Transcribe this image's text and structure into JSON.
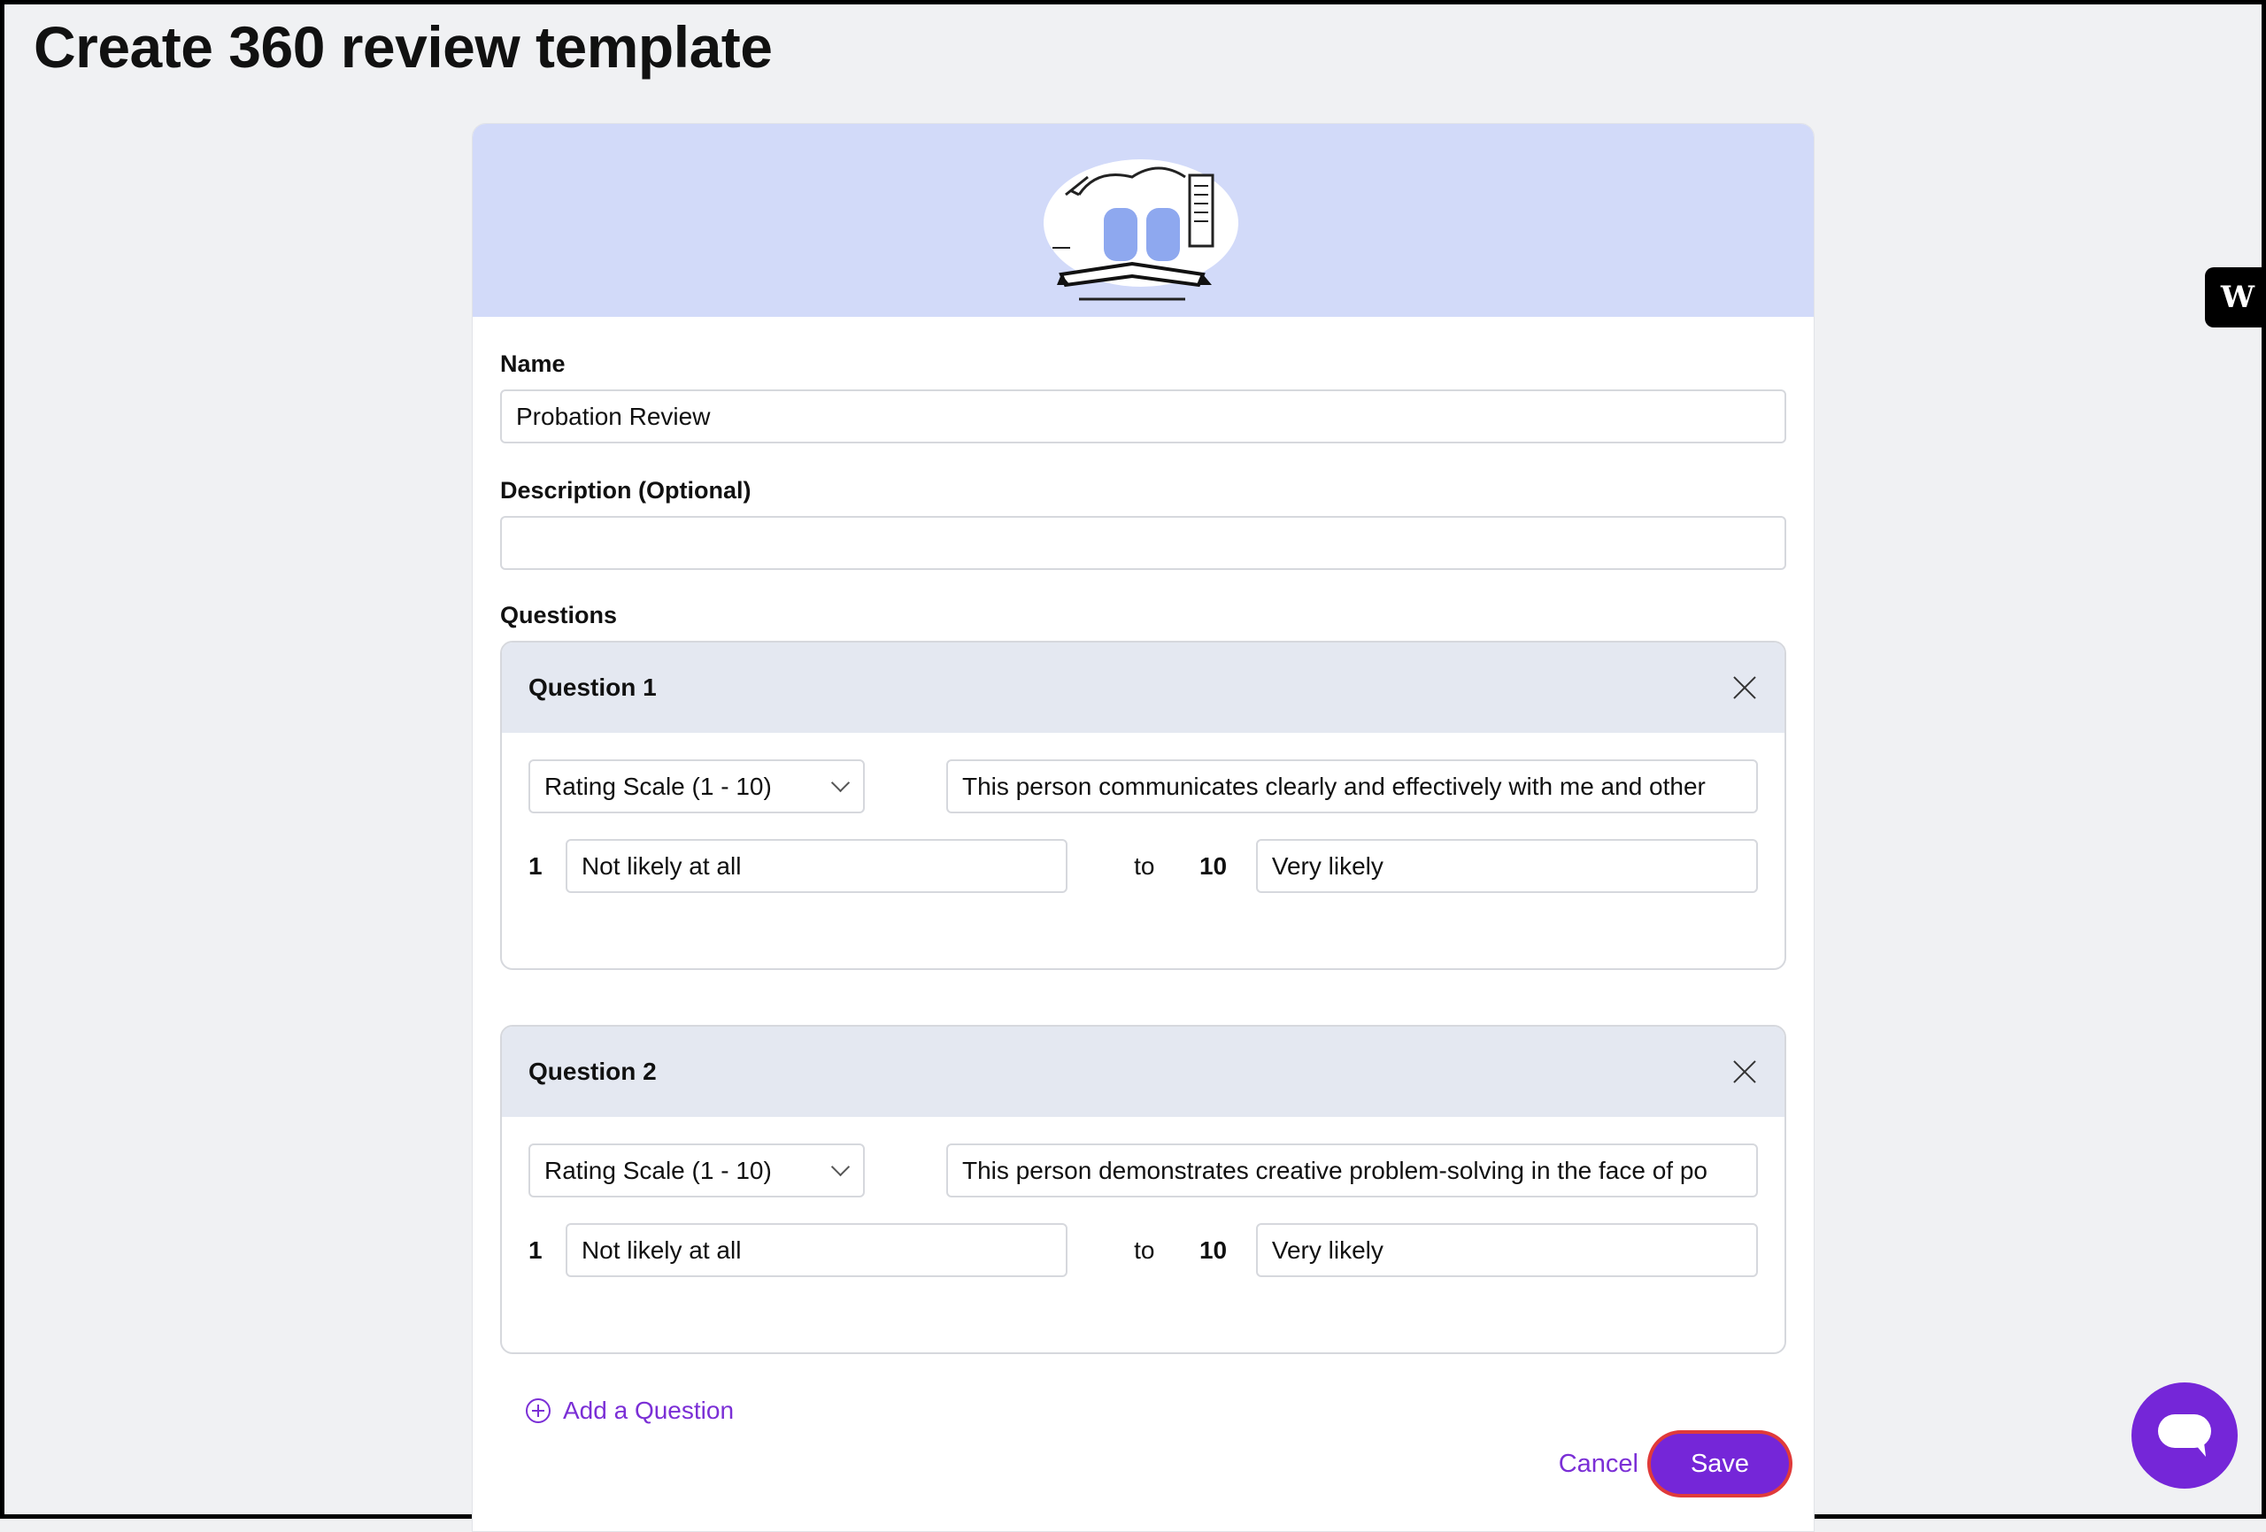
{
  "page": {
    "title": "Create 360 review template"
  },
  "form": {
    "name_label": "Name",
    "name_value": "Probation Review",
    "description_label": "Description (Optional)",
    "description_value": "",
    "questions_label": "Questions"
  },
  "questions": [
    {
      "title": "Question 1",
      "type": "Rating Scale (1 - 10)",
      "text": "This person communicates clearly and effectively with me and other",
      "low_num": "1",
      "low_label": "Not likely at all",
      "to": "to",
      "high_num": "10",
      "high_label": "Very likely"
    },
    {
      "title": "Question 2",
      "type": "Rating Scale (1 - 10)",
      "text": "This person demonstrates creative problem-solving in the face of po",
      "low_num": "1",
      "low_label": "Not likely at all",
      "to": "to",
      "high_num": "10",
      "high_label": "Very likely"
    }
  ],
  "actions": {
    "add_question": "Add a Question",
    "cancel": "Cancel",
    "save": "Save"
  },
  "badge": {
    "letter": "W"
  },
  "icons": {
    "close": "close-icon",
    "chevron": "chevron-down-icon",
    "add": "plus-circle-icon",
    "chat": "chat-icon"
  },
  "colors": {
    "accent": "#7526d8",
    "banner": "#d2daf9",
    "question_header": "#e4e8f1"
  }
}
